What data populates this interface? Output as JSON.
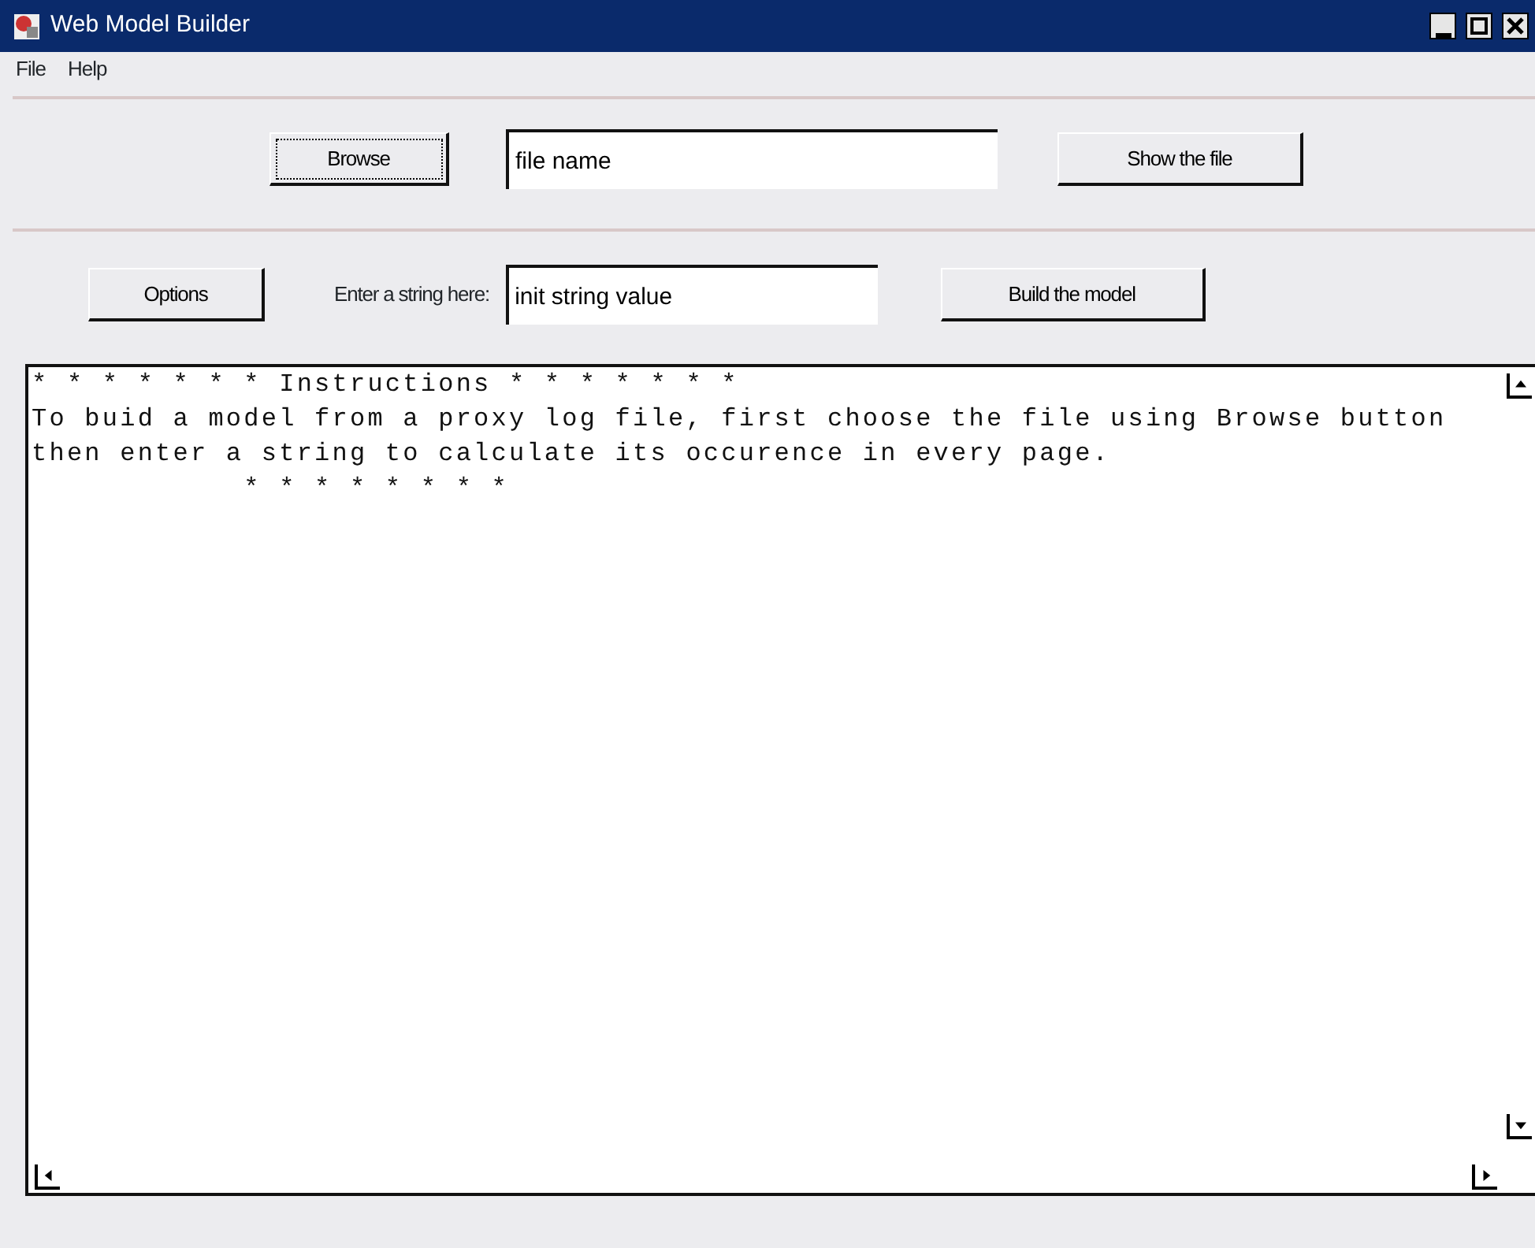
{
  "window": {
    "title": "Web Model Builder"
  },
  "menu": [
    {
      "label": "File"
    },
    {
      "label": "Help"
    }
  ],
  "file_panel": {
    "browse_button": {
      "label": "Browse",
      "focused": true
    },
    "file_field": {
      "value": "file name"
    },
    "show_button": {
      "label": "Show the file"
    }
  },
  "model_panel": {
    "options_button": {
      "label": "Options"
    },
    "string_label": "Enter a string here:",
    "string_field": {
      "value": "init string value"
    },
    "build_button": {
      "label": "Build the model"
    }
  },
  "output": {
    "lines": [
      "* * * * * * * Instructions * * * * * * *",
      "To buid a model from a proxy log file, first choose the file using Browse button",
      "then enter a string to calculate its occurence in every page.",
      "            * * * * * * * *"
    ]
  }
}
